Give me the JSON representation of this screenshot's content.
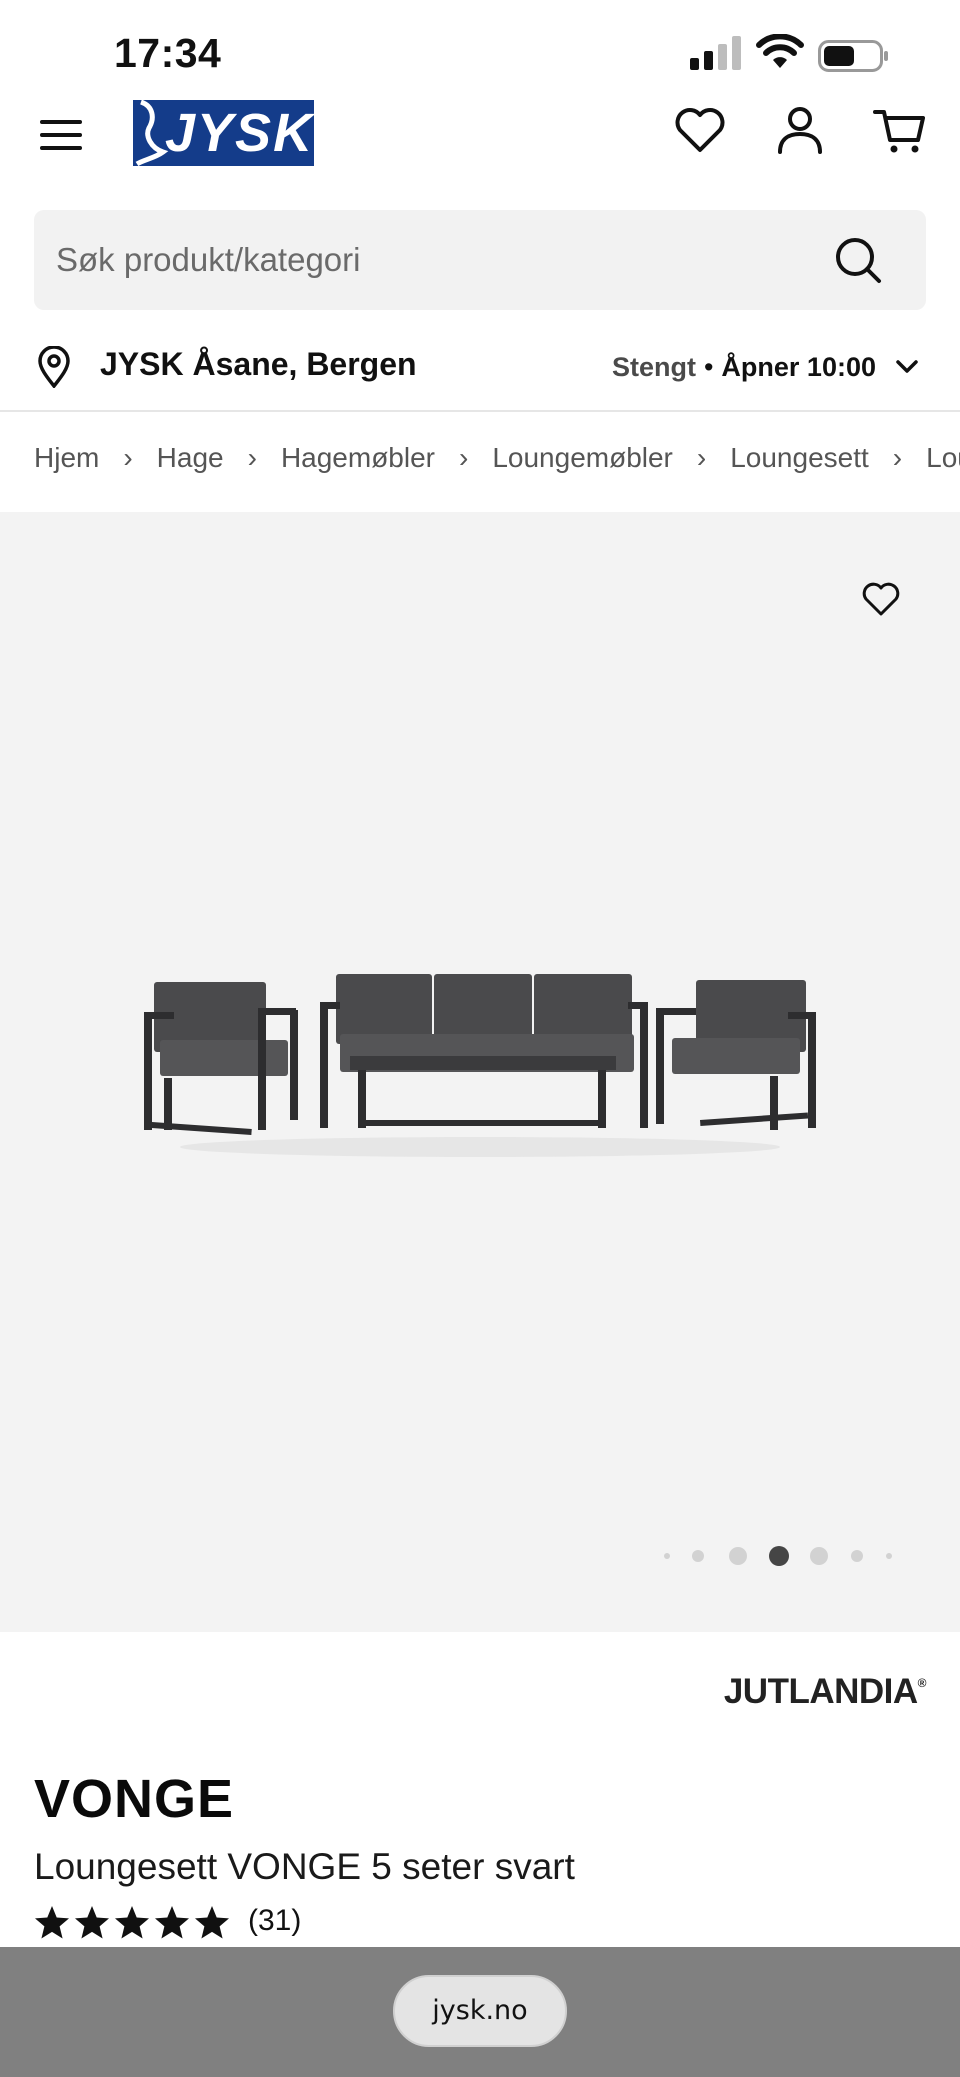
{
  "status_bar": {
    "time": "17:34"
  },
  "header": {
    "logo_text": "JYSK",
    "brand_color": "#143c8a",
    "icons": [
      "menu-icon",
      "heart-icon",
      "user-icon",
      "cart-icon"
    ]
  },
  "search": {
    "placeholder": "Søk produkt/kategori"
  },
  "store": {
    "name": "JYSK Åsane, Bergen",
    "status": "Stengt",
    "separator": "•",
    "opens": "Åpner 10:00"
  },
  "breadcrumb": {
    "items": [
      "Hjem",
      "Hage",
      "Hagemøbler",
      "Loungemøbler",
      "Loungesett",
      "Lou"
    ]
  },
  "gallery": {
    "image_count": 7,
    "active_index": 3
  },
  "product": {
    "brand": "JUTLANDIA",
    "brand_mark": "®",
    "name": "VONGE",
    "subtitle": "Loungesett VONGE 5 seter svart",
    "rating_stars": 5,
    "review_count": "(31)"
  },
  "browser": {
    "url": "jysk.no"
  }
}
